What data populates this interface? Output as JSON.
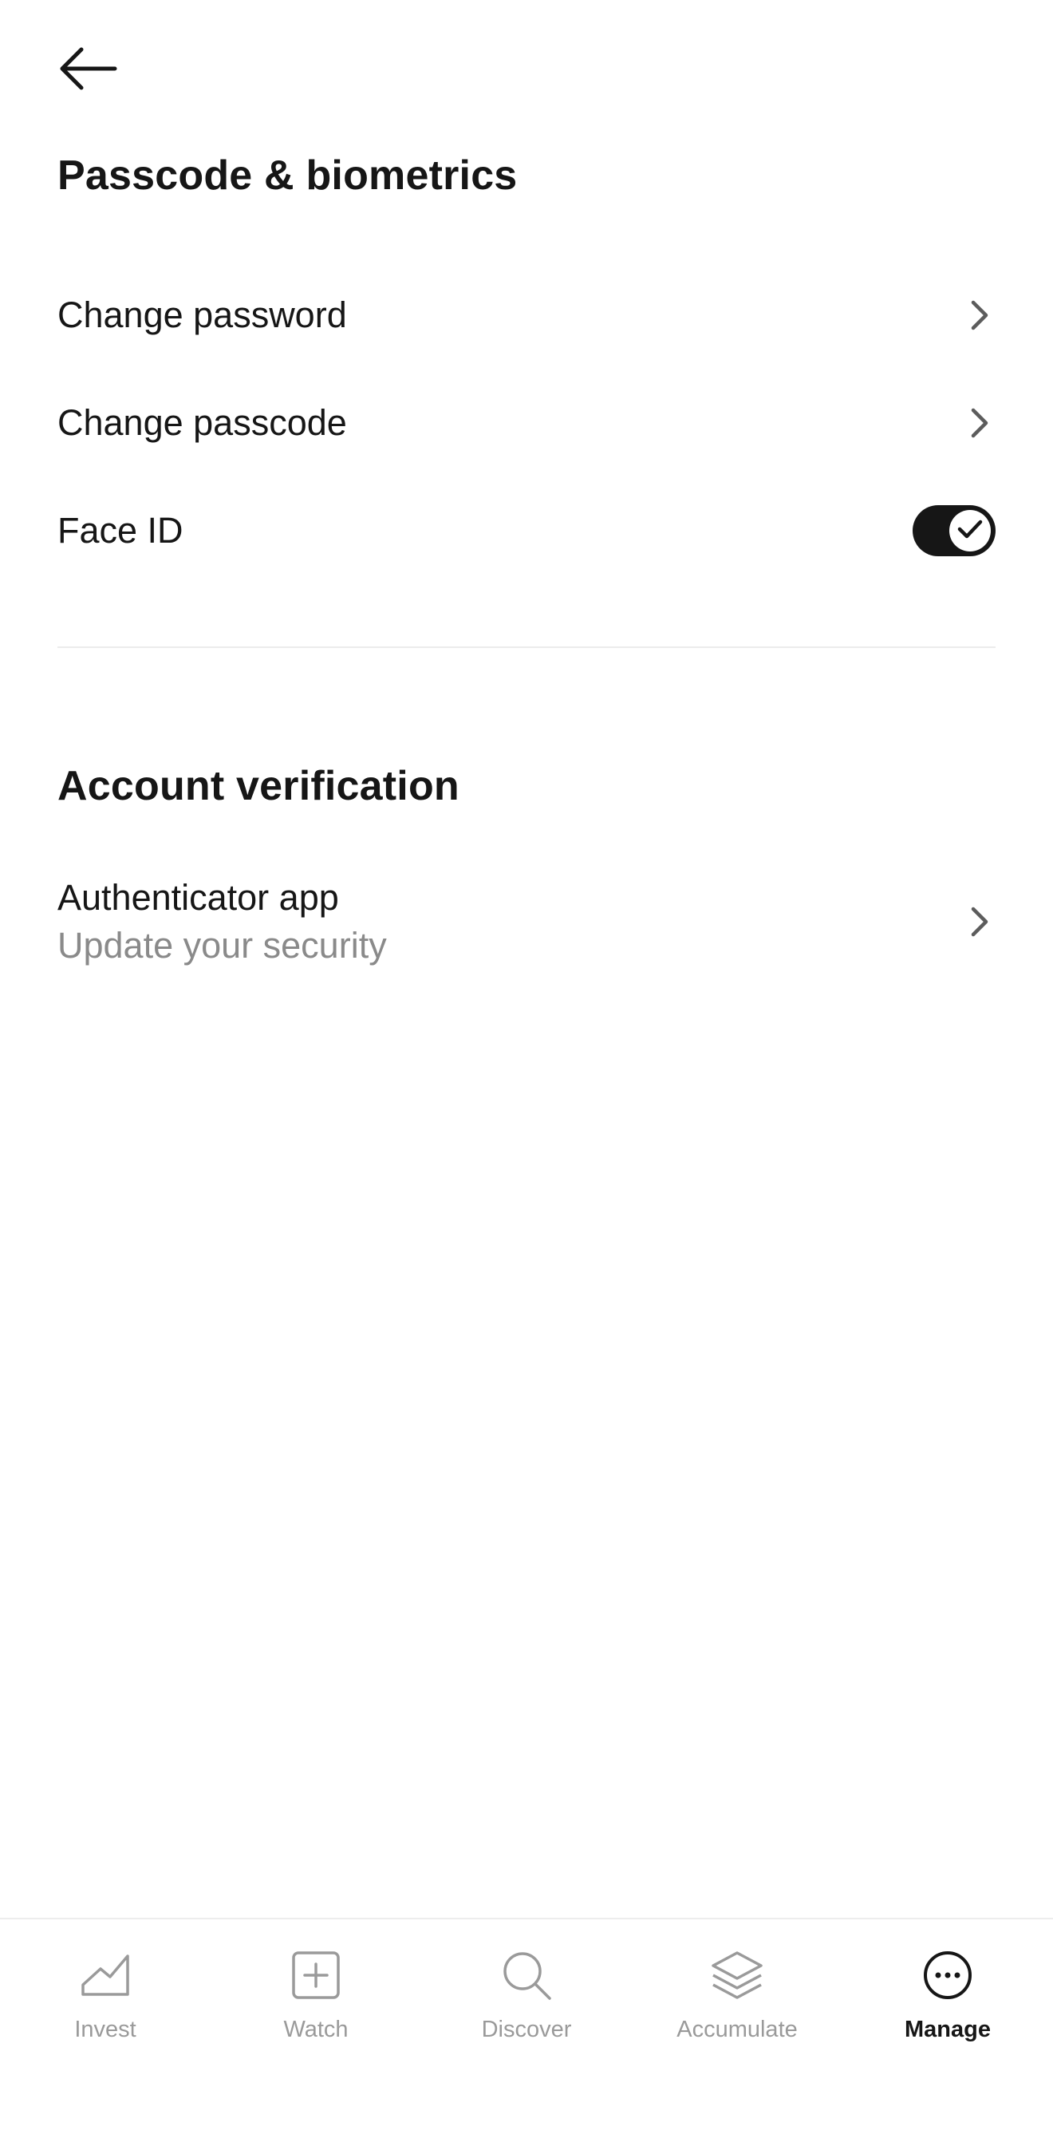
{
  "header": {
    "back_icon": "arrow-left-icon"
  },
  "section_passcode": {
    "title": "Passcode & biometrics",
    "items": [
      {
        "label": "Change password",
        "icon": "chevron-right-icon"
      },
      {
        "label": "Change passcode",
        "icon": "chevron-right-icon"
      },
      {
        "label": "Face ID",
        "toggle_on": true
      }
    ]
  },
  "section_verification": {
    "title": "Account verification",
    "items": [
      {
        "label": "Authenticator app",
        "subtitle": "Update your security",
        "icon": "chevron-right-icon"
      }
    ]
  },
  "tabbar": {
    "tabs": [
      {
        "label": "Invest",
        "icon": "chart-line-icon",
        "active": false
      },
      {
        "label": "Watch",
        "icon": "plus-square-icon",
        "active": false
      },
      {
        "label": "Discover",
        "icon": "search-icon",
        "active": false
      },
      {
        "label": "Accumulate",
        "icon": "layers-icon",
        "active": false
      },
      {
        "label": "Manage",
        "icon": "more-circle-icon",
        "active": true
      }
    ]
  },
  "colors": {
    "text": "#161616",
    "subtext": "#8a8a8a",
    "inactive_tab": "#9a9a9a",
    "toggle_on": "#161616",
    "divider": "#ececec"
  }
}
